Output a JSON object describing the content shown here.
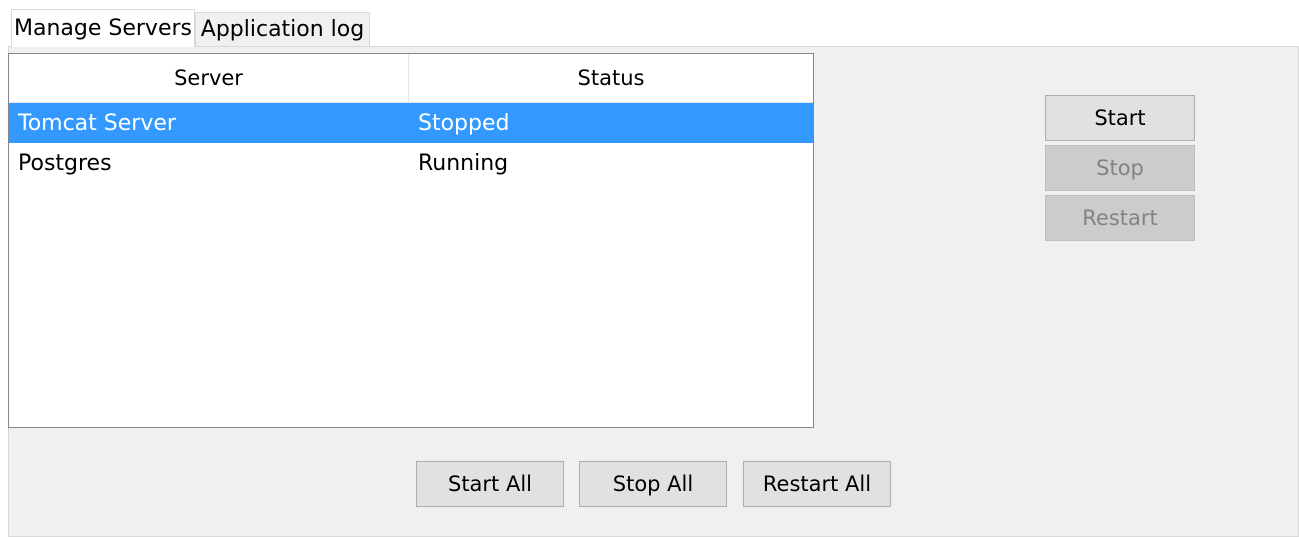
{
  "tabs": [
    {
      "label": "Manage Servers",
      "active": true
    },
    {
      "label": "Application log",
      "active": false
    }
  ],
  "table": {
    "columns": [
      "Server",
      "Status"
    ],
    "rows": [
      {
        "server": "Tomcat Server",
        "status": "Stopped",
        "selected": true
      },
      {
        "server": "Postgres",
        "status": "Running",
        "selected": false
      }
    ]
  },
  "side_buttons": {
    "start": "Start",
    "stop": "Stop",
    "restart": "Restart"
  },
  "bottom_buttons": {
    "start_all": "Start All",
    "stop_all": "Stop All",
    "restart_all": "Restart All"
  },
  "colors": {
    "selection": "#3399ff",
    "panel": "#f0f0f0",
    "button": "#e1e1e1",
    "button_disabled": "#cccccc"
  }
}
